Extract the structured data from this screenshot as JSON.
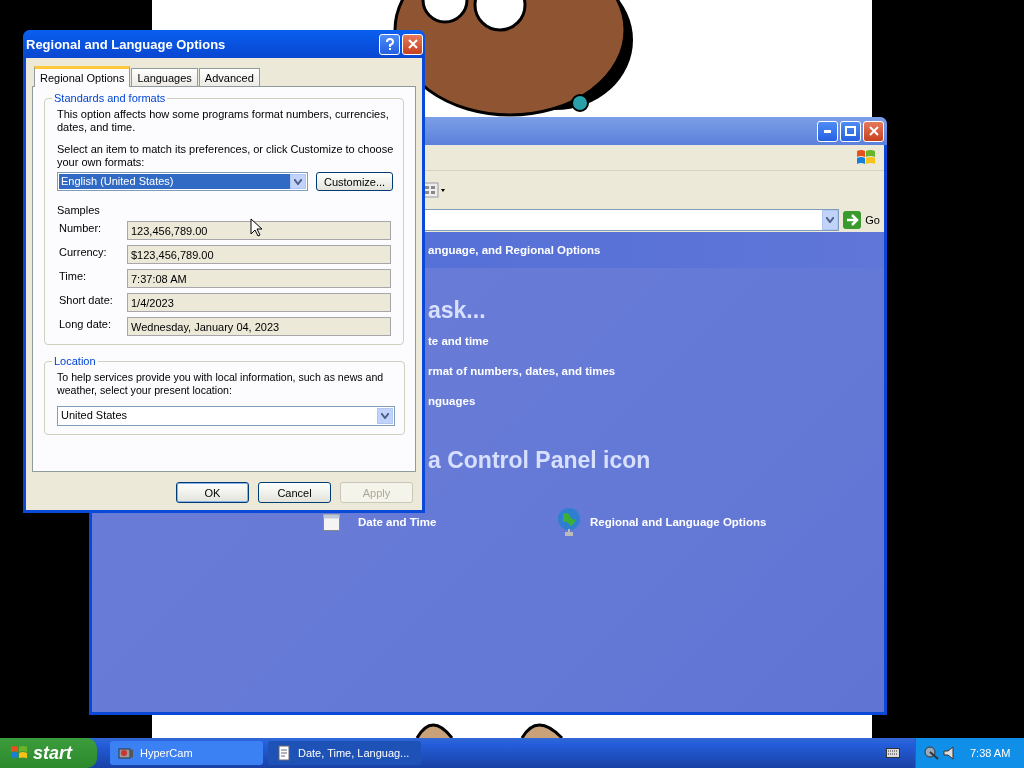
{
  "explorer_window": {
    "go_button": "Go",
    "header": "anguage, and Regional Options",
    "task_heading": "ask...",
    "tasks": [
      "te and time",
      "rmat of numbers, dates, and times",
      "nguages"
    ],
    "icon_heading": "a Control Panel icon",
    "icons": [
      {
        "label": "Date and Time",
        "kind": "calendar"
      },
      {
        "label": "Regional and Language Options",
        "kind": "globe"
      }
    ]
  },
  "dialog": {
    "title": "Regional and Language Options",
    "tabs": [
      {
        "label": "Regional Options",
        "selected": true
      },
      {
        "label": "Languages",
        "selected": false
      },
      {
        "label": "Advanced",
        "selected": false
      }
    ],
    "standards": {
      "legend": "Standards and formats",
      "description": "This option affects how some programs format numbers, currencies, dates, and time.",
      "instruction": "Select an item to match its preferences, or click Customize to choose your own formats:",
      "format_select": "English (United States)",
      "customize_button": "Customize...",
      "samples_label": "Samples",
      "samples": [
        {
          "label": "Number:",
          "value": "123,456,789.00"
        },
        {
          "label": "Currency:",
          "value": "$123,456,789.00"
        },
        {
          "label": "Time:",
          "value": "7:37:08 AM"
        },
        {
          "label": "Short date:",
          "value": "1/4/2023"
        },
        {
          "label": "Long date:",
          "value": "Wednesday, January 04, 2023"
        }
      ]
    },
    "location": {
      "legend": "Location",
      "description": "To help services provide you with local information, such as news and weather, select your present location:",
      "select": "United States"
    },
    "buttons": [
      {
        "label": "OK",
        "disabled": false,
        "default": true
      },
      {
        "label": "Cancel",
        "disabled": false,
        "default": false
      },
      {
        "label": "Apply",
        "disabled": true,
        "default": false
      }
    ]
  },
  "taskbar": {
    "start": "start",
    "tasks": [
      {
        "label": "HyperCam",
        "selected": false,
        "kind": "camera"
      },
      {
        "label": "Date, Time, Languag...",
        "selected": true,
        "kind": "document"
      }
    ],
    "clock": "7:38 AM"
  }
}
